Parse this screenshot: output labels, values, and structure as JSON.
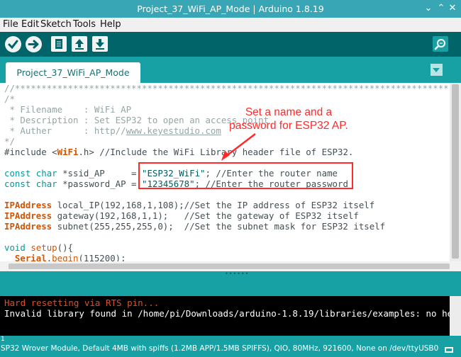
{
  "window": {
    "title": "Project_37_WiFi_AP_Mode | Arduino 1.8.19"
  },
  "menu": [
    "File",
    "Edit",
    "Sketch",
    "Tools",
    "Help"
  ],
  "toolbar": {
    "verify_icon": "check-icon",
    "upload_icon": "arrow-right-icon",
    "new_icon": "file-icon",
    "open_icon": "arrow-up-icon",
    "save_icon": "arrow-down-icon",
    "serial_monitor_icon": "magnifier-icon"
  },
  "tab": {
    "label": "Project_37_WiFi_AP_Mode"
  },
  "code": {
    "line1": "//**************************************************************************************",
    "line2": "/*",
    "line3": " * Filename    : WiFi AP",
    "line4": " * Description : Set ESP32 to open an access point",
    "line5a": " * Auther      : http//",
    "line5b": "www.keyestudio.com",
    "line6": "*/",
    "line7a": "#include <",
    "line7b": "WiFi",
    "line7c": ".h> //Include the WiFi Library header file of ESP32.",
    "line9a": "const",
    "line9b": "char",
    "line9c": " *ssid_AP     = ",
    "line9d": "\"ESP32_WiFi\"",
    "line9e": "; //Enter the router name",
    "line10a": "const",
    "line10b": "char",
    "line10c": " *password_AP = ",
    "line10d": "\"12345678\"",
    "line10e": "; //Enter the router password",
    "line12a": "IPAddress",
    "line12b": " local_IP(192,168,1,108);",
    "line12c": "//Set the IP address of ESP32 itself",
    "line13a": "IPAddress",
    "line13b": " gateway(192,168,1,1);   ",
    "line13c": "//Set the gateway of ESP32 itself",
    "line14a": "IPAddress",
    "line14b": " subnet(255,255,255,0);  ",
    "line14c": "//Set the subnet mask for ESP32 itself",
    "line16a": "void",
    "line16b": " ",
    "line16c": "setup",
    "line16d": "(){",
    "line17a": "  ",
    "line17b": "Serial",
    "line17c": ".",
    "line17d": "begin",
    "line17e": "(115200);"
  },
  "annotation": {
    "line1": "Set a name and a",
    "line2": "password for ESP32 AP."
  },
  "console": {
    "line1": "Hard resetting via RTS pin...",
    "line2": "Invalid library found in /home/pi/Downloads/arduino-1.8.19/libraries/examples: no he"
  },
  "status": {
    "line_number": "1",
    "board": "SP32 Wrover Module, Default 4MB with spiffs (1.2MB APP/1.5MB SPIFFS), QIO, 80MHz, 921600, None on /dev/ttyUSB0"
  },
  "colors": {
    "teal": "#17a1a5",
    "dark_teal": "#006468",
    "annotation": "#ff2a2a",
    "console_error": "#e34c22"
  }
}
